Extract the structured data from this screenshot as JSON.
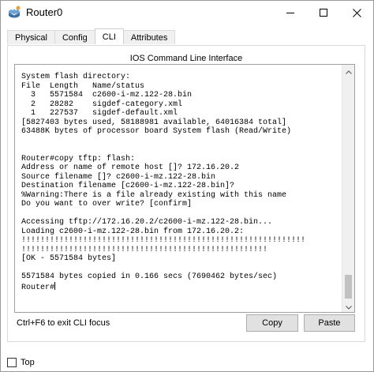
{
  "window": {
    "title": "Router0",
    "icon": "router-icon",
    "controls": [
      "minimize-icon",
      "maximize-icon",
      "close-icon"
    ]
  },
  "tabs": [
    {
      "label": "Physical",
      "active": false
    },
    {
      "label": "Config",
      "active": false
    },
    {
      "label": "CLI",
      "active": true
    },
    {
      "label": "Attributes",
      "active": false
    }
  ],
  "cli": {
    "heading": "IOS Command Line Interface",
    "lines": [
      "System flash directory:",
      "File  Length   Name/status",
      "  3   5571584  c2600-i-mz.122-28.bin",
      "  2   28282    sigdef-category.xml",
      "  1   227537   sigdef-default.xml",
      "[5827403 bytes used, 58188981 available, 64016384 total]",
      "63488K bytes of processor board System flash (Read/Write)",
      "",
      "",
      "Router#copy tftp: flash:",
      "Address or name of remote host []? 172.16.20.2",
      "Source filename []? c2600-i-mz.122-28.bin",
      "Destination filename [c2600-i-mz.122-28.bin]?",
      "%Warning:There is a file already existing with this name",
      "Do you want to over write? [confirm]",
      "",
      "Accessing tftp://172.16.20.2/c2600-i-mz.122-28.bin...",
      "Loading c2600-i-mz.122-28.bin from 172.16.20.2:",
      "!!!!!!!!!!!!!!!!!!!!!!!!!!!!!!!!!!!!!!!!!!!!!!!!!!!!!!!!!!!!",
      "!!!!!!!!!!!!!!!!!!!!!!!!!!!!!!!!!!!!!!!!!!!!!!!!!!!!",
      "[OK - 5571584 bytes]",
      "",
      "5571584 bytes copied in 0.166 secs (7690462 bytes/sec)"
    ],
    "prompt": "Router#"
  },
  "footer": {
    "hint": "Ctrl+F6 to exit CLI focus",
    "copy_label": "Copy",
    "paste_label": "Paste"
  },
  "top_checkbox": {
    "label": "Top",
    "checked": false
  }
}
